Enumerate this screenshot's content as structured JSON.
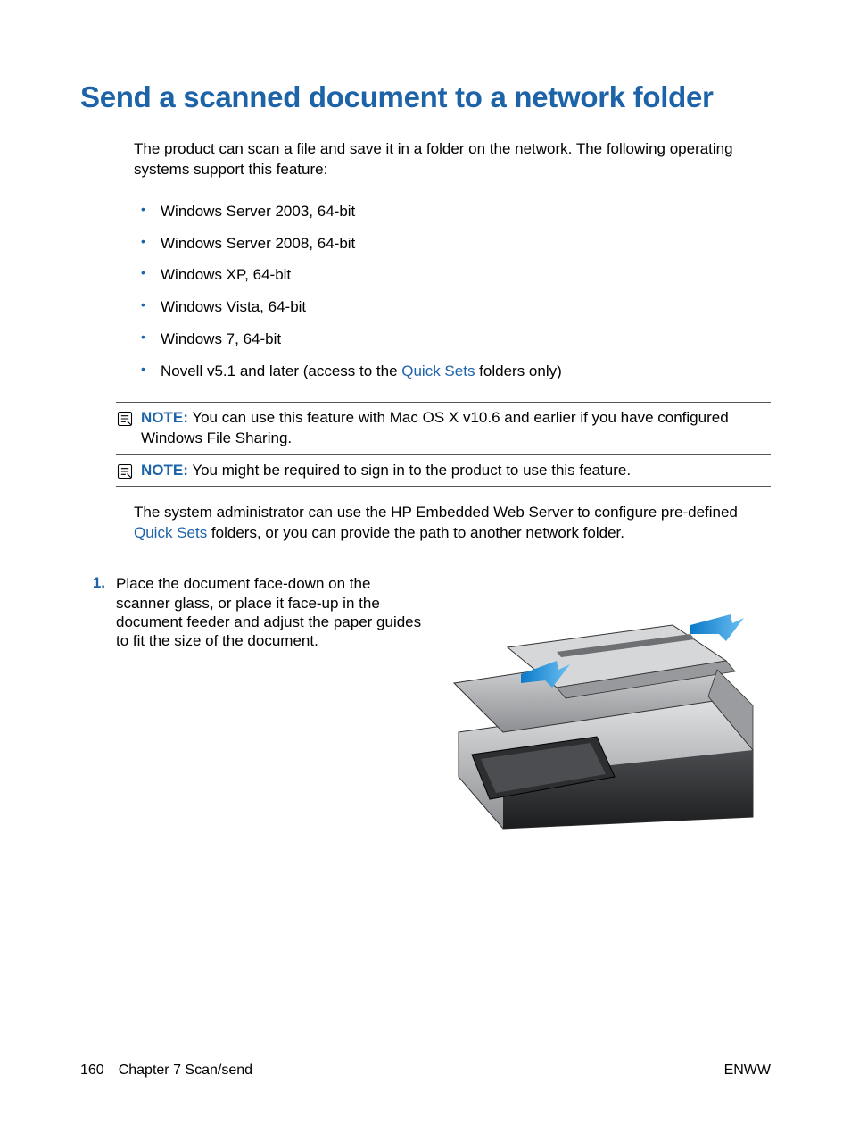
{
  "title": "Send a scanned document to a network folder",
  "intro": "The product can scan a file and save it in a folder on the network. The following operating systems support this feature:",
  "os_list": [
    "Windows Server 2003, 64-bit",
    "Windows Server 2008, 64-bit",
    "Windows XP, 64-bit",
    "Windows Vista, 64-bit",
    "Windows 7, 64-bit"
  ],
  "os_last_prefix": "Novell v5.1 and later (access to the ",
  "os_last_link": "Quick Sets",
  "os_last_suffix": " folders only)",
  "note_label": "NOTE:",
  "note1": "You can use this feature with Mac OS X v10.6 and earlier if you have configured Windows File Sharing.",
  "note2": "You might be required to sign in to the product to use this feature.",
  "body_prefix": "The system administrator can use the HP Embedded Web Server to configure pre-defined ",
  "body_link": "Quick Sets",
  "body_suffix": " folders, or you can provide the path to another network folder.",
  "step": {
    "num": "1.",
    "text": "Place the document face-down on the scanner glass, or place it face-up in the document feeder and adjust the paper guides to fit the size of the document."
  },
  "footer": {
    "page": "160",
    "chapter": "Chapter 7   Scan/send",
    "right": "ENWW"
  }
}
